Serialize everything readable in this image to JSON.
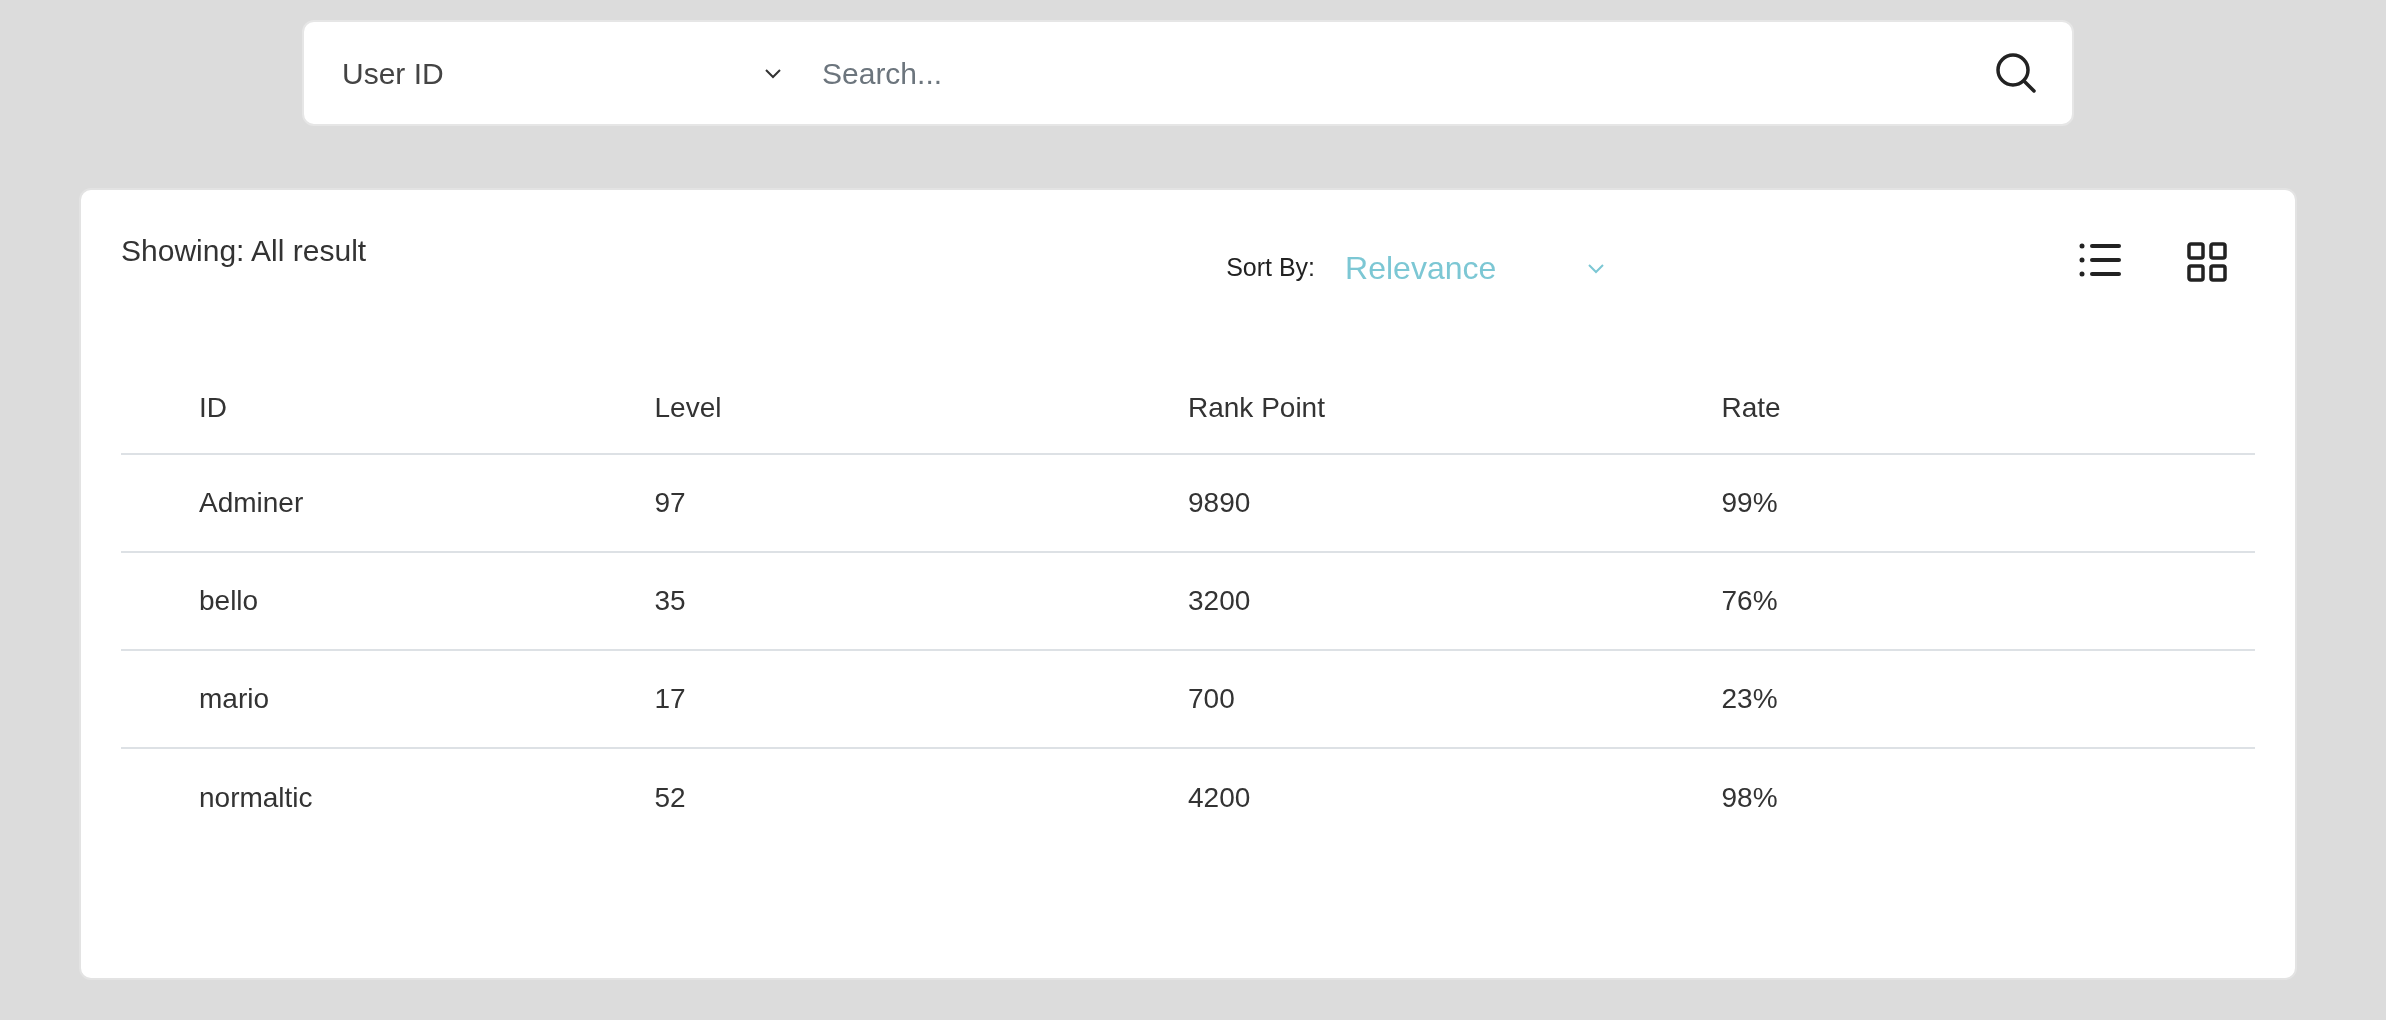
{
  "search_bar": {
    "filter": "User ID",
    "placeholder": "Search..."
  },
  "results": {
    "showing": "Showing: All result",
    "sort_label": "Sort By:",
    "sort_value": "Relevance"
  },
  "table": {
    "columns": [
      "ID",
      "Level",
      "Rank Point",
      "Rate"
    ],
    "rows": [
      [
        "Adminer",
        "97",
        "9890",
        "99%"
      ],
      [
        "bello",
        "35",
        "3200",
        "76%"
      ],
      [
        "mario",
        "17",
        "700",
        "23%"
      ],
      [
        "normaltic",
        "52",
        "4200",
        "98%"
      ]
    ]
  }
}
